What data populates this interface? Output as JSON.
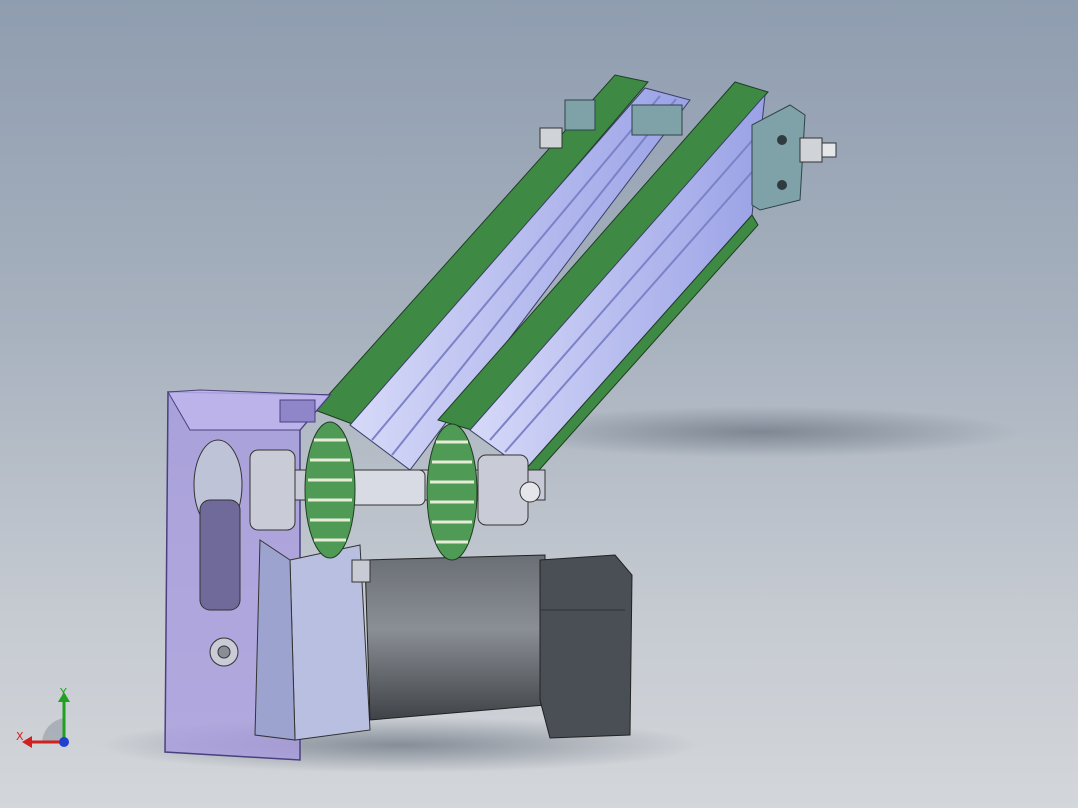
{
  "view": {
    "background_top": "#8f9db0",
    "background_bottom": "#d3d6da"
  },
  "model": {
    "belt_color": "#3e8a45",
    "pulley_color": "#4f9a55",
    "rail_color": "#b7bdf0",
    "housing_color": "#a79ae0",
    "motor_color": "#555a60",
    "block_color": "#7fa1a8"
  },
  "triad": {
    "x_label": "X",
    "y_label": "Y",
    "x_color": "#d02020",
    "y_color": "#20a020",
    "z_color": "#2040d0"
  }
}
